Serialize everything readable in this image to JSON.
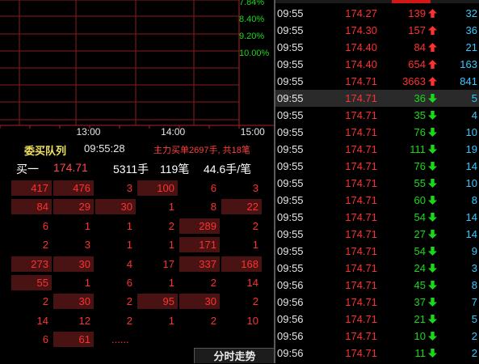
{
  "chart": {
    "pct_labels": [
      "7.84%",
      "8.40%",
      "9.20%",
      "10.00%"
    ],
    "time_ticks": [
      {
        "label": "13:00",
        "pos": 0.322
      },
      {
        "label": "14:00",
        "pos": 0.63
      },
      {
        "label": "15:00",
        "pos": 0.92
      }
    ]
  },
  "queue": {
    "title": "委买队列",
    "time": "09:55:28",
    "info": "主力买单2697手, 共18笔",
    "buy_label": "买一",
    "buy_price": "174.71",
    "buy_volume": "5311手",
    "buy_count": "119笔",
    "buy_avg": "44.6手/笔",
    "rows": [
      [
        "417",
        "476",
        "3",
        "100",
        "6",
        "3"
      ],
      [
        "84",
        "29",
        "30",
        "1",
        "8",
        "22"
      ],
      [
        "6",
        "1",
        "1",
        "2",
        "289",
        "2"
      ],
      [
        "2",
        "3",
        "1",
        "1",
        "171",
        "1"
      ],
      [
        "273",
        "30",
        "4",
        "17",
        "337",
        "168"
      ],
      [
        "55",
        "1",
        "6",
        "1",
        "2",
        "14"
      ],
      [
        "2",
        "30",
        "2",
        "95",
        "30",
        "2"
      ],
      [
        "14",
        "12",
        "2",
        "1",
        "2",
        "10"
      ],
      [
        "6",
        "61",
        "......",
        "",
        "",
        ""
      ]
    ],
    "highlights": [
      [
        true,
        true,
        false,
        true,
        false,
        false
      ],
      [
        true,
        true,
        true,
        false,
        false,
        true
      ],
      [
        false,
        false,
        false,
        false,
        true,
        false
      ],
      [
        false,
        false,
        false,
        false,
        true,
        false
      ],
      [
        true,
        true,
        false,
        false,
        true,
        true
      ],
      [
        true,
        false,
        false,
        false,
        false,
        false
      ],
      [
        false,
        true,
        false,
        true,
        true,
        false
      ],
      [
        false,
        false,
        false,
        false,
        false,
        false
      ],
      [
        false,
        true,
        false,
        false,
        false,
        false
      ]
    ]
  },
  "bottom_tab": "分时走势",
  "trades": [
    {
      "time": "09:55",
      "price": "174.27",
      "vol": "139",
      "dir": "up",
      "count": "32"
    },
    {
      "time": "09:55",
      "price": "174.30",
      "vol": "157",
      "dir": "up",
      "count": "36"
    },
    {
      "time": "09:55",
      "price": "174.40",
      "vol": "84",
      "dir": "up",
      "count": "21"
    },
    {
      "time": "09:55",
      "price": "174.40",
      "vol": "654",
      "dir": "up",
      "count": "163"
    },
    {
      "time": "09:55",
      "price": "174.71",
      "vol": "3663",
      "dir": "up",
      "count": "841"
    },
    {
      "time": "09:55",
      "price": "174.71",
      "vol": "36",
      "dir": "down",
      "count": "5",
      "selected": true
    },
    {
      "time": "09:55",
      "price": "174.71",
      "vol": "35",
      "dir": "down",
      "count": "4"
    },
    {
      "time": "09:55",
      "price": "174.71",
      "vol": "76",
      "dir": "down",
      "count": "10"
    },
    {
      "time": "09:55",
      "price": "174.71",
      "vol": "111",
      "dir": "down",
      "count": "19"
    },
    {
      "time": "09:55",
      "price": "174.71",
      "vol": "76",
      "dir": "down",
      "count": "14"
    },
    {
      "time": "09:55",
      "price": "174.71",
      "vol": "55",
      "dir": "down",
      "count": "10"
    },
    {
      "time": "09:55",
      "price": "174.71",
      "vol": "60",
      "dir": "down",
      "count": "8"
    },
    {
      "time": "09:55",
      "price": "174.71",
      "vol": "54",
      "dir": "down",
      "count": "14"
    },
    {
      "time": "09:55",
      "price": "174.71",
      "vol": "27",
      "dir": "down",
      "count": "14"
    },
    {
      "time": "09:55",
      "price": "174.71",
      "vol": "54",
      "dir": "down",
      "count": "9"
    },
    {
      "time": "09:55",
      "price": "174.71",
      "vol": "24",
      "dir": "down",
      "count": "3"
    },
    {
      "time": "09:56",
      "price": "174.71",
      "vol": "45",
      "dir": "down",
      "count": "8"
    },
    {
      "time": "09:56",
      "price": "174.71",
      "vol": "37",
      "dir": "down",
      "count": "7"
    },
    {
      "time": "09:56",
      "price": "174.71",
      "vol": "21",
      "dir": "down",
      "count": "5"
    },
    {
      "time": "09:56",
      "price": "174.71",
      "vol": "10",
      "dir": "down",
      "count": "2"
    },
    {
      "time": "09:56",
      "price": "174.71",
      "vol": "11",
      "dir": "down",
      "count": "2"
    }
  ],
  "colors": {
    "up": "#ff3030",
    "down": "#19d919",
    "count": "#36c8ff",
    "grid_line": "#8b1c1c",
    "highlight": "#4a1313"
  }
}
